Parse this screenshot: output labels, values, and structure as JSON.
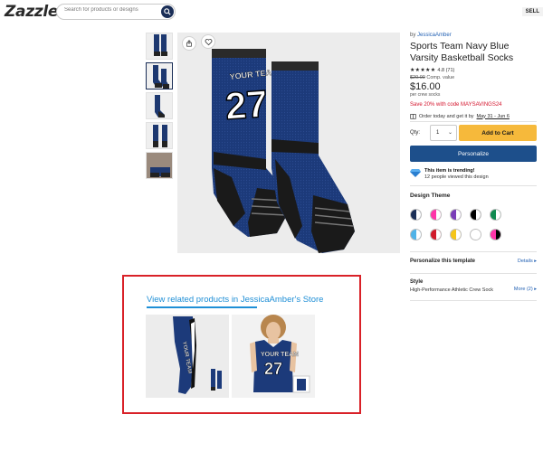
{
  "header": {
    "logo": "Zazzle",
    "search_placeholder": "Search for products or designs",
    "sell_label": "SELL"
  },
  "thumbnails": [
    {
      "name": "socks-pair-front"
    },
    {
      "name": "socks-pair-side"
    },
    {
      "name": "socks-single"
    },
    {
      "name": "socks-back"
    },
    {
      "name": "socks-model"
    }
  ],
  "main_image": {
    "team_text": "YOUR TEAM",
    "number": "27"
  },
  "product": {
    "by_prefix": "by",
    "designer": "JessicaAmber",
    "title": "Sports Team Navy Blue Varsity Basketball Socks",
    "stars": "★★★★★",
    "rating": "4.8 (71)",
    "compare_price": "$20.00",
    "compare_label": "Comp. value",
    "price": "$16.00",
    "per_unit": "per crew socks",
    "promo": "Save 20% with code MAYSAVINGS24",
    "order_prefix": "Order today and get it by",
    "order_date": "May 31 - Jun 6"
  },
  "purchase": {
    "qty_label": "Qty:",
    "qty_value": "1",
    "add_to_cart": "Add to Cart",
    "personalize": "Personalize"
  },
  "trending": {
    "headline": "This item is trending!",
    "detail": "12 people viewed this design"
  },
  "design_theme": {
    "title": "Design Theme",
    "swatches": [
      {
        "left": "#1a2e57",
        "right": "#ffffff"
      },
      {
        "left": "#ff33a8",
        "right": "#ffffff"
      },
      {
        "left": "#7a3db8",
        "right": "#ffffff"
      },
      {
        "left": "#000000",
        "right": "#ffffff"
      },
      {
        "left": "#0e8a4f",
        "right": "#ffffff"
      },
      {
        "left": "#4fb3e8",
        "right": "#ffffff"
      },
      {
        "left": "#d11a2a",
        "right": "#ffffff"
      },
      {
        "left": "#f5c518",
        "right": "#ffffff"
      },
      {
        "left": "#ffffff",
        "right": "#ffffff"
      },
      {
        "left": "#ff33a8",
        "right": "#000000"
      }
    ]
  },
  "personalize_template": {
    "label": "Personalize this template",
    "link": "Details ▸"
  },
  "style": {
    "label": "Style",
    "value": "High-Performance Athletic Crew Sock",
    "link": "More (2) ▸"
  },
  "related": {
    "title": "View related products in JessicaAmber's Store",
    "items": [
      {
        "name": "leggings",
        "team_text": "YOUR TEAM"
      },
      {
        "name": "tank-top",
        "team_text": "YOUR TEAM",
        "number": "27"
      }
    ]
  }
}
